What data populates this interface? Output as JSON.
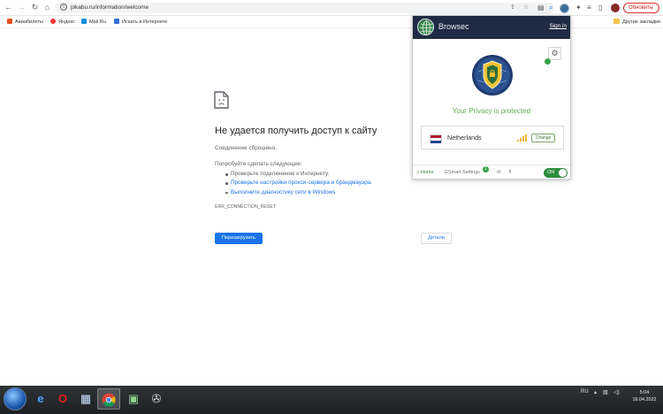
{
  "browser": {
    "url": "pikabu.ru/information/welcome",
    "update_button": "Обновить",
    "update_more": "⋮"
  },
  "bookmarks": {
    "items": [
      {
        "label": "Авиабилеты",
        "color": "#e8511f"
      },
      {
        "label": "Яндекс",
        "color": "#f33"
      },
      {
        "label": "Mail.Ru",
        "color": "#168de2"
      },
      {
        "label": "Искать в Интернете",
        "color": "#2f6fd4"
      }
    ],
    "other": "Другие закладки"
  },
  "error_page": {
    "title": "Не удается получить доступ к сайту",
    "subtitle": "Соединение сброшено.",
    "try_label": "Попробуйте сделать следующее:",
    "suggestions": [
      "Проверьте подключение к Интернету.",
      "Проверьте настройки прокси-сервера и брандмауэра.",
      "Выполните диагностику сети в Windows"
    ],
    "error_code": "ERR_CONNECTION_RESET",
    "reload_button": "Перезагрузить",
    "details_button": "Детали"
  },
  "browsec": {
    "brand": "Browsec",
    "sign_in": "Sign in",
    "status": "Your Privacy is protected",
    "location": "Netherlands",
    "change_button": "Change",
    "footer": {
      "home": "Home",
      "smart_settings": "Smart Settings",
      "smart_settings_badge": "1",
      "toggle": "ON"
    },
    "colors": {
      "header": "#1f2a44",
      "accent": "#37a24a",
      "status_text": "#5eae4c"
    }
  },
  "taskbar": {
    "language": "RU",
    "time": "5:04",
    "date": "16.04.2022"
  }
}
